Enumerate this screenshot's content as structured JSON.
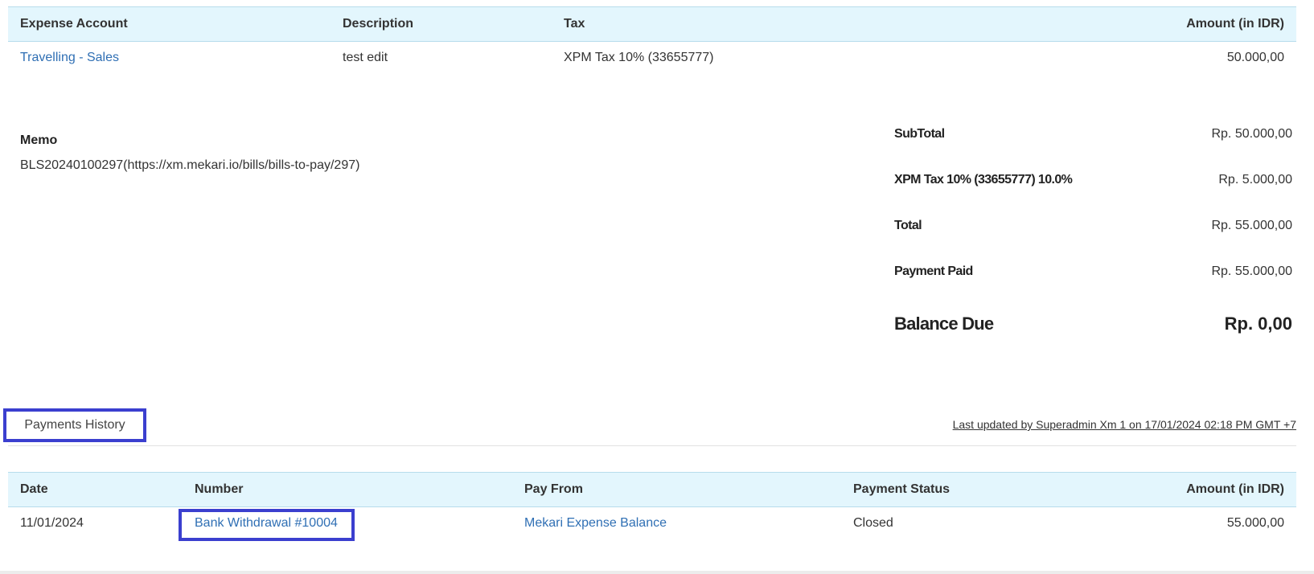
{
  "expense_table": {
    "headers": {
      "account": "Expense Account",
      "description": "Description",
      "tax": "Tax",
      "amount": "Amount (in IDR)"
    },
    "rows": [
      {
        "account": "Travelling - Sales",
        "description": "test edit",
        "tax": "XPM Tax 10% (33655777)",
        "amount": "50.000,00"
      }
    ]
  },
  "memo": {
    "label": "Memo",
    "value": "BLS20240100297(https://xm.mekari.io/bills/bills-to-pay/297)"
  },
  "totals": {
    "subtotal_label": "SubTotal",
    "subtotal_value": "Rp. 50.000,00",
    "tax_label": "XPM Tax 10% (33655777) 10.0%",
    "tax_value": "Rp. 5.000,00",
    "total_label": "Total",
    "total_value": "Rp. 55.000,00",
    "paid_label": "Payment Paid",
    "paid_value": "Rp. 55.000,00",
    "balance_label": "Balance Due",
    "balance_value": "Rp. 0,00"
  },
  "tabs": {
    "payments_history": "Payments History",
    "last_updated": "Last updated by Superadmin Xm 1 on 17/01/2024 02:18 PM GMT +7"
  },
  "payments_table": {
    "headers": {
      "date": "Date",
      "number": "Number",
      "pay_from": "Pay From",
      "status": "Payment Status",
      "amount": "Amount (in IDR)"
    },
    "rows": [
      {
        "date": "11/01/2024",
        "number": "Bank Withdrawal #10004",
        "pay_from": "Mekari Expense Balance",
        "status": "Closed",
        "amount": "55.000,00"
      }
    ]
  },
  "colors": {
    "header_bg": "#e3f6fd",
    "link": "#2f6fb4",
    "highlight": "#3b3fcf"
  }
}
